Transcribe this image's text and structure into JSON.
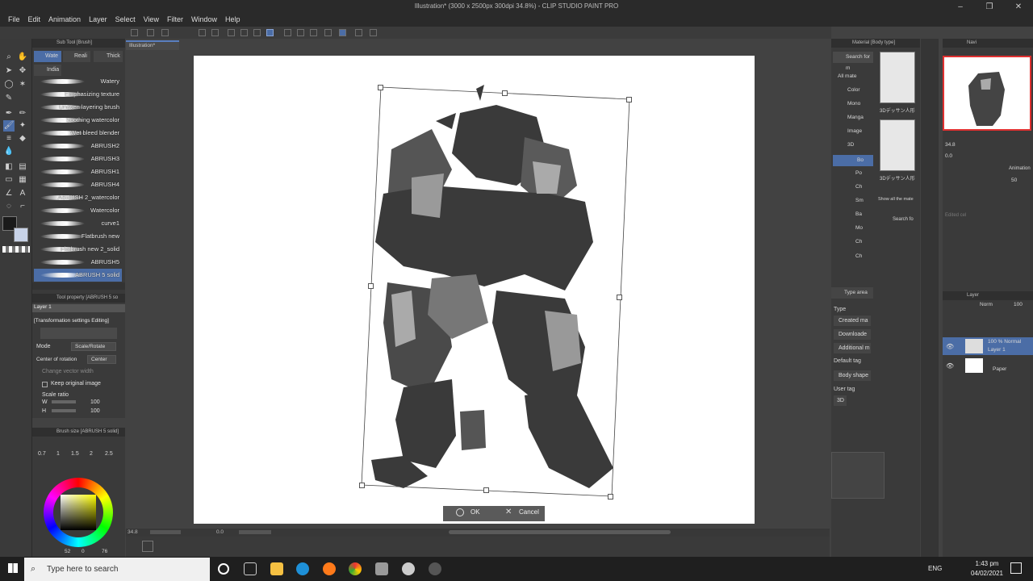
{
  "window": {
    "title": "Illustration* (3000 x 2500px 300dpi 34.8%) - CLIP STUDIO PAINT PRO"
  },
  "menu": [
    "File",
    "Edit",
    "Animation",
    "Layer",
    "Select",
    "View",
    "Filter",
    "Window",
    "Help"
  ],
  "subtool": {
    "header": "Sub Tool [Brush]",
    "tabs": [
      "Wate",
      "Reali",
      "Thick",
      "India"
    ],
    "brushes": [
      "Watery",
      "Emphasizing texture",
      "Uneven layering brush",
      "Soothing watercolor",
      "Wet bleed blender",
      "ABRUSH2",
      "ABRUSH3",
      "ABRUSH1",
      "ABRUSH4",
      "ABRUSH 2_watercolor",
      "Watercolor",
      "curve1",
      "Flatbrush new",
      "Flatbrush new 2_solid",
      "ABRUSH5",
      "ABRUSH 5 solid"
    ],
    "selected": "ABRUSH 5 solid"
  },
  "toolprop": {
    "header": "Tool property [ABRUSH 5 so",
    "layer": "Layer 1",
    "title": "[Transformation settings Editing]",
    "mode_label": "Mode",
    "mode_value": "Scale/Rotate",
    "center_label": "Center of rotation",
    "center_value": "Center",
    "change_vector": "Change vector width",
    "keep_original": "Keep original image",
    "scale_ratio": "Scale ratio",
    "w_label": "W",
    "w_value": "100",
    "h_label": "H",
    "h_value": "100"
  },
  "brushsize": {
    "header": "Brush size [ABRUSH 5 solid]",
    "sizes": [
      "0.7",
      "1",
      "1.5",
      "2",
      "2.5"
    ]
  },
  "color": {
    "r": "52",
    "sep": "0",
    "b": "76"
  },
  "canvas": {
    "tab": "Illustration*",
    "zoom": "34.8",
    "angle": "0.0"
  },
  "transform": {
    "ok": "OK",
    "cancel": "Cancel"
  },
  "material": {
    "header": "Material [Body type]",
    "search": "Search for m",
    "tree": [
      "All mate",
      "Color",
      "Mono",
      "Manga",
      "Image",
      "3D",
      "Bo",
      "Po",
      "Ch",
      "Sm",
      "Ba",
      "Mo",
      "Ch",
      "Ch"
    ],
    "thumb1": "3Dデッサン人形",
    "thumb2": "3Dデッサン人形",
    "show_all": "Show all the mate",
    "search_for": "Search fo",
    "type_area": "Type area",
    "type_label": "Type",
    "types": [
      "Created ma",
      "Downloade",
      "Additional m"
    ],
    "default_tag": "Default tag",
    "tag_body": "Body shape",
    "user_tag": "User tag",
    "tag_3d": "3D"
  },
  "navigator": {
    "header": "Navi",
    "zoom": "34.8",
    "angle": "0.0"
  },
  "sub": {
    "animation": "Animation",
    "opacity": "50",
    "edited": "Edited cel"
  },
  "layer": {
    "header": "Layer",
    "mode": "Norm",
    "opacity": "100",
    "layer1_info": "100 % Normal",
    "layer1_name": "Layer 1",
    "paper": "Paper"
  },
  "taskbar": {
    "search": "Type here to search",
    "lang": "ENG",
    "time": "1:43 pm",
    "date": "04/02/2021"
  }
}
